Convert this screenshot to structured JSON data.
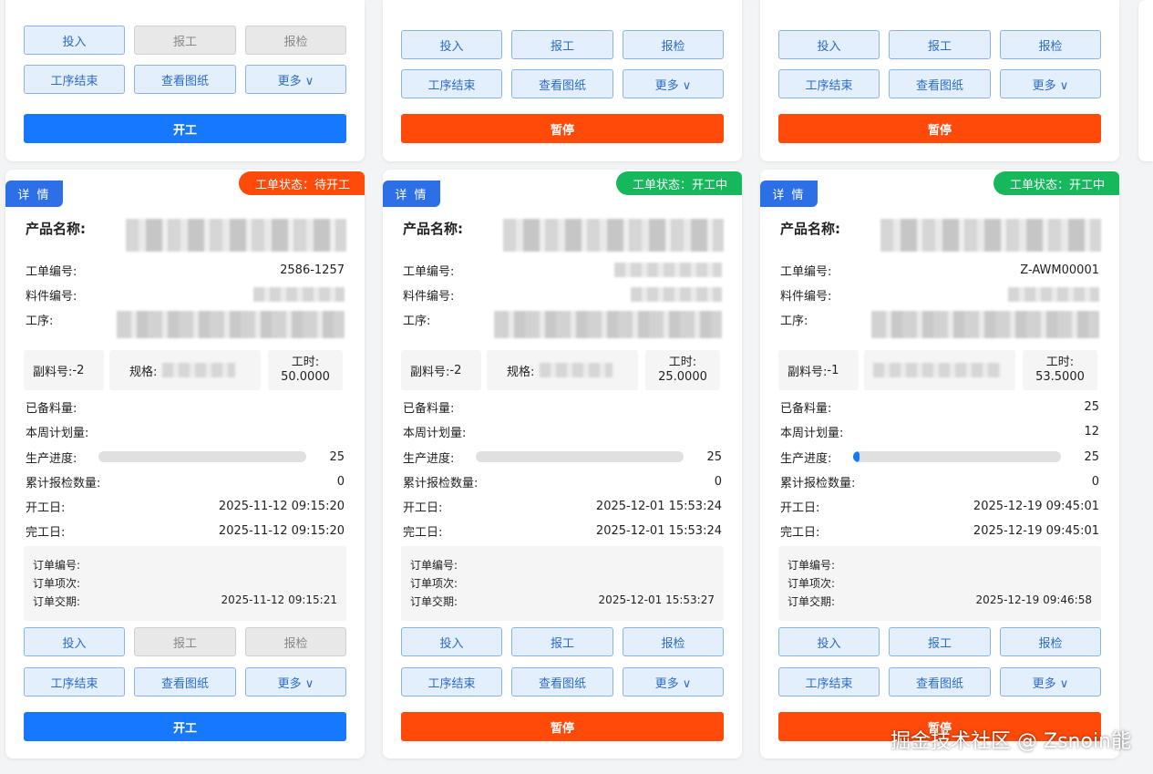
{
  "labels": {
    "detail_tag": "详 情",
    "product_name": "产品名称:",
    "work_order_no": "工单编号:",
    "material_no": "料件编号:",
    "process": "工序:",
    "sub_material": "副料号:",
    "spec": "规格:",
    "hours": "工时:",
    "prepared_qty": "已备料量:",
    "weekly_plan": "本周计划量:",
    "progress": "生产进度:",
    "inspect_total": "累计报检数量:",
    "start_date": "开工日:",
    "finish_date": "完工日:",
    "order_no": "订单编号:",
    "order_item": "订单项次:",
    "order_due": "订单交期:"
  },
  "buttons": {
    "input": "投入",
    "report": "报工",
    "inspect": "报检",
    "process_end": "工序结束",
    "drawing": "查看图纸",
    "more": "更多 ∨",
    "start": "开工",
    "pause": "暂停"
  },
  "top_cards": [
    {
      "main_action": "开工",
      "action_color": "blue",
      "report_disabled": true
    },
    {
      "main_action": "暂停",
      "action_color": "orange",
      "report_disabled": false
    },
    {
      "main_action": "暂停",
      "action_color": "orange",
      "report_disabled": false
    }
  ],
  "cards": [
    {
      "status": "工单状态：待开工",
      "status_color": "#ff4a0a",
      "work_order_no": "2586-1257",
      "sub_material": "-2",
      "hours": "50.0000",
      "prepared_qty": "",
      "weekly_plan": "",
      "progress_total": "25",
      "progress_fraction": 0,
      "inspect_total": "0",
      "start_date": "2025-11-12 09:15:20",
      "finish_date": "2025-11-12 09:15:20",
      "order_due": "2025-11-12 09:15:21",
      "main_action": "开工",
      "action_color": "blue"
    },
    {
      "status": "工单状态：开工中",
      "status_color": "#17b85c",
      "work_order_no": "",
      "sub_material": "-2",
      "hours": "25.0000",
      "prepared_qty": "",
      "weekly_plan": "",
      "progress_total": "25",
      "progress_fraction": 0,
      "inspect_total": "0",
      "start_date": "2025-12-01 15:53:24",
      "finish_date": "2025-12-01 15:53:24",
      "order_due": "2025-12-01 15:53:27",
      "main_action": "暂停",
      "action_color": "orange"
    },
    {
      "status": "工单状态：开工中",
      "status_color": "#17b85c",
      "work_order_no": "Z-AWM00001",
      "sub_material": "-1",
      "hours": "53.5000",
      "prepared_qty": "25",
      "weekly_plan": "12",
      "progress_total": "25",
      "progress_fraction": 0.03,
      "inspect_total": "0",
      "start_date": "2025-12-19 09:45:01",
      "finish_date": "2025-12-19 09:45:01",
      "order_due": "2025-12-19 09:46:58",
      "main_action": "暂停",
      "action_color": "orange"
    }
  ],
  "watermark": "掘金技术社区 @ Zsnoin能"
}
